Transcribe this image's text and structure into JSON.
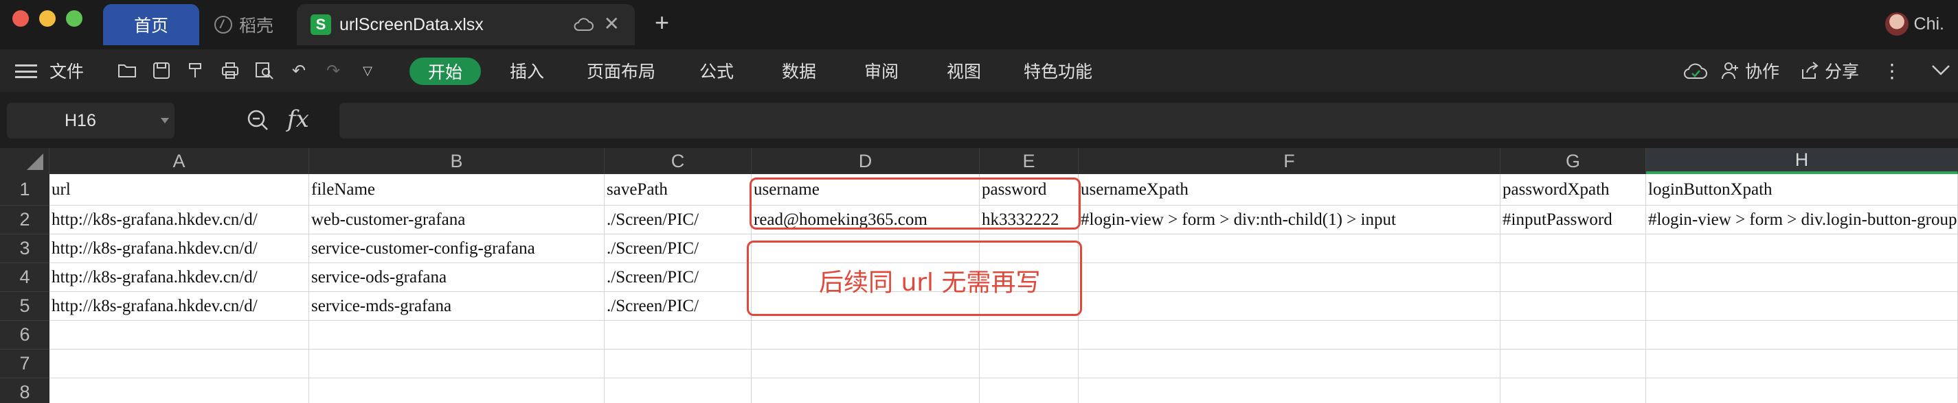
{
  "tabs": {
    "home": "首页",
    "daoke": "稻壳",
    "file_icon_letter": "S",
    "file": "urlScreenData.xlsx",
    "user": "Chi."
  },
  "menu": {
    "file": "文件",
    "start": "开始",
    "items": [
      "插入",
      "页面布局",
      "公式",
      "数据",
      "审阅",
      "视图",
      "特色功能"
    ],
    "collab": "协作",
    "share": "分享"
  },
  "formula_bar": {
    "name_box": "H16",
    "fx": "fx",
    "content": ""
  },
  "columns": [
    "A",
    "B",
    "C",
    "D",
    "E",
    "F",
    "G",
    "H"
  ],
  "selected_column": "H",
  "rows": [
    "1",
    "2",
    "3",
    "4",
    "5",
    "6",
    "7",
    "8"
  ],
  "cells": [
    [
      "url",
      "fileName",
      "savePath",
      "username",
      "password",
      "usernameXpath",
      "passwordXpath",
      "loginButtonXpath"
    ],
    [
      "http://k8s-grafana.hkdev.cn/d/",
      "web-customer-grafana",
      "./Screen/PIC/",
      "read@homeking365.com",
      "hk3332222",
      "#login-view > form > div:nth-child(1) > input",
      "#inputPassword",
      "#login-view > form > div.login-button-group > button"
    ],
    [
      "http://k8s-grafana.hkdev.cn/d/",
      "service-customer-config-grafana",
      "./Screen/PIC/",
      "",
      "",
      "",
      "",
      ""
    ],
    [
      "http://k8s-grafana.hkdev.cn/d/",
      "service-ods-grafana",
      "./Screen/PIC/",
      "",
      "",
      "",
      "",
      ""
    ],
    [
      "http://k8s-grafana.hkdev.cn/d/",
      "service-mds-grafana",
      "./Screen/PIC/",
      "",
      "",
      "",
      "",
      ""
    ],
    [
      "",
      "",
      "",
      "",
      "",
      "",
      "",
      ""
    ],
    [
      "",
      "",
      "",
      "",
      "",
      "",
      "",
      ""
    ],
    [
      "",
      "",
      "",
      "",
      "",
      "",
      "",
      ""
    ]
  ],
  "annotation": {
    "note": "后续同 url 无需再写",
    "color": "#e0483a"
  },
  "colors": {
    "home_tab": "#2e52a3",
    "start_button": "#1f8f4e",
    "file_icon": "#24a148"
  }
}
